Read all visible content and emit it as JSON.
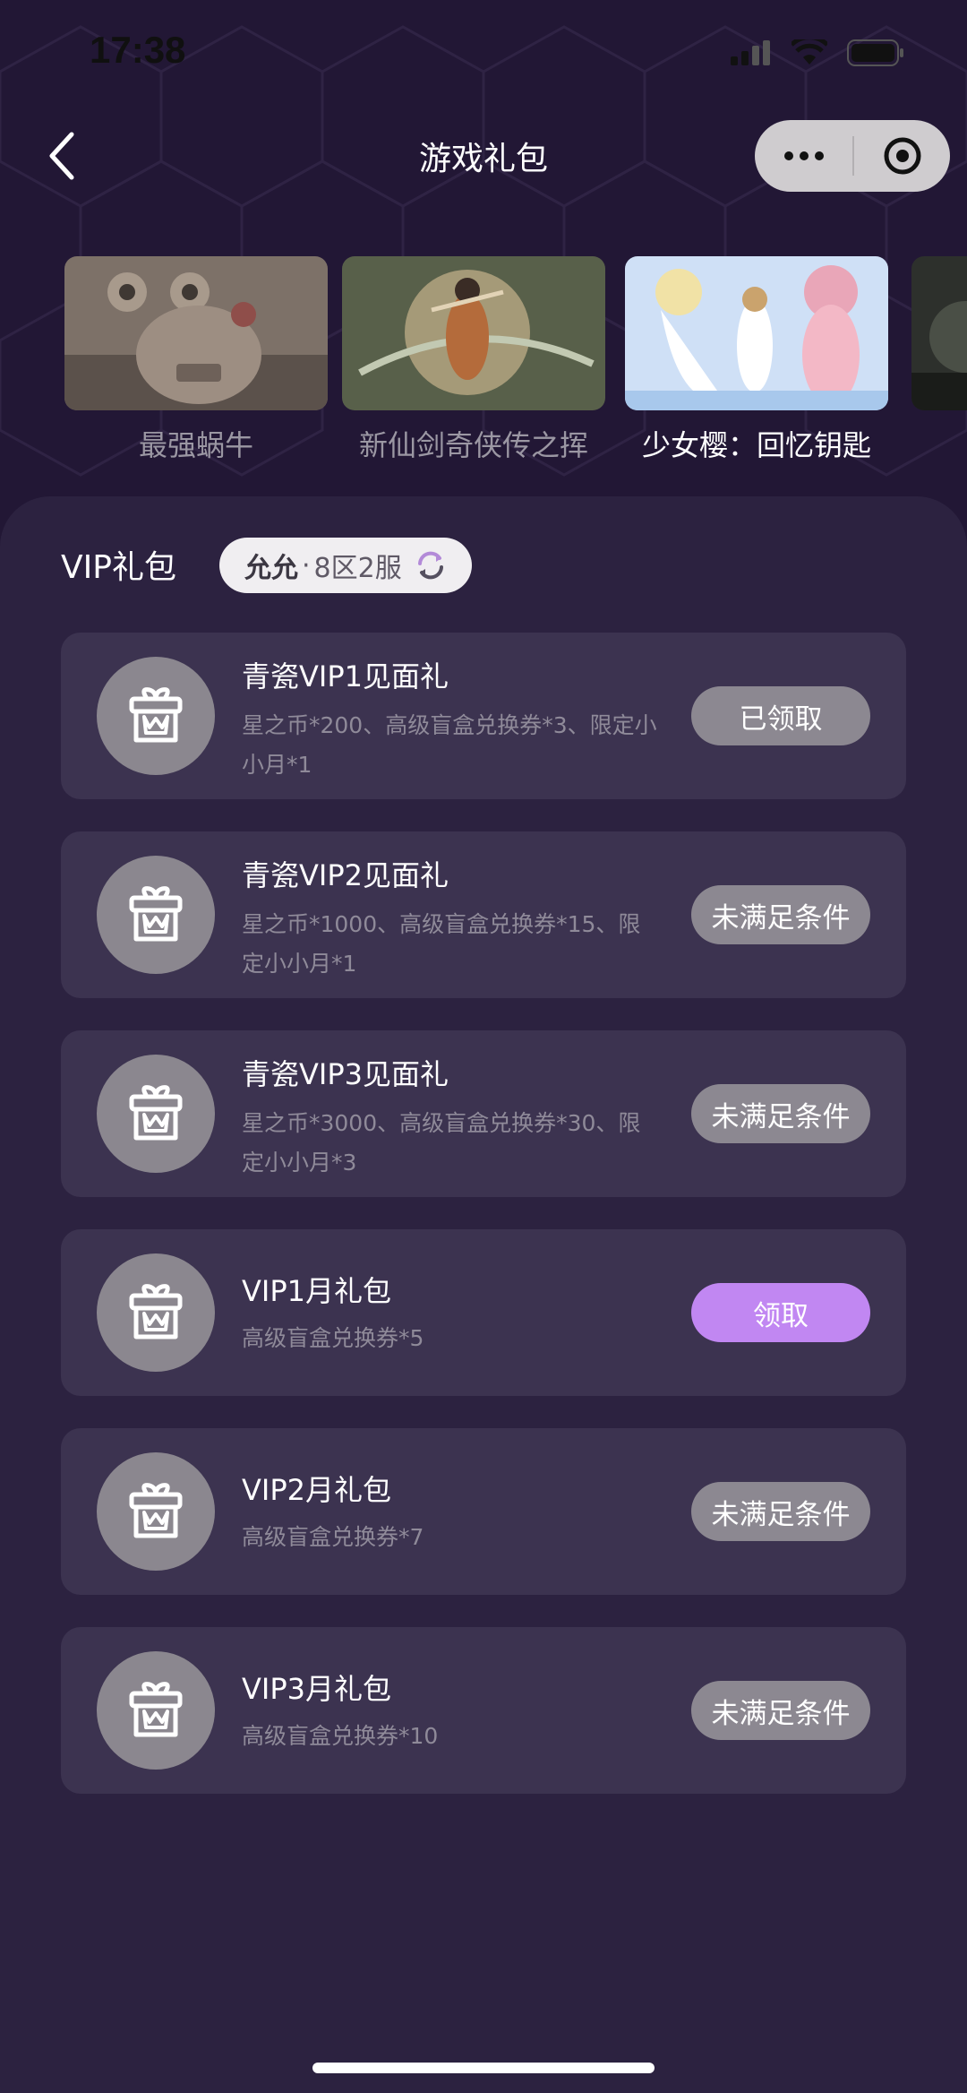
{
  "status_bar": {
    "time": "17:38"
  },
  "nav": {
    "title": "游戏礼包"
  },
  "games": [
    {
      "name": "最强蜗牛",
      "active": false
    },
    {
      "name": "新仙剑奇侠传之挥",
      "active": false
    },
    {
      "name": "少女樱：回忆钥匙",
      "active": true
    }
  ],
  "vip_section": {
    "title": "VIP礼包",
    "server": {
      "game": "允允",
      "separator": "·",
      "zone": "8区2服"
    }
  },
  "gifts": [
    {
      "name": "青瓷VIP1见面礼",
      "desc": "星之币*200、高级盲盒兑换券*3、限定小小月*1",
      "button": "已领取",
      "state": "claimed"
    },
    {
      "name": "青瓷VIP2见面礼",
      "desc": "星之币*1000、高级盲盒兑换券*15、限定小小月*1",
      "button": "未满足条件",
      "state": "locked"
    },
    {
      "name": "青瓷VIP3见面礼",
      "desc": "星之币*3000、高级盲盒兑换券*30、限定小小月*3",
      "button": "未满足条件",
      "state": "locked"
    },
    {
      "name": "VIP1月礼包",
      "desc": "高级盲盒兑换券*5",
      "button": "领取",
      "state": "available"
    },
    {
      "name": "VIP2月礼包",
      "desc": "高级盲盒兑换券*7",
      "button": "未满足条件",
      "state": "locked"
    },
    {
      "name": "VIP3月礼包",
      "desc": "高级盲盒兑换券*10",
      "button": "未满足条件",
      "state": "locked"
    }
  ],
  "colors": {
    "background": "#221735",
    "panel": "#2c2240",
    "card": "#3c3350",
    "claim_button": "#c187f2",
    "disabled_button": "#8c8891"
  },
  "icons": {
    "back": "chevron-left-icon",
    "more": "more-dots-icon",
    "close": "target-circle-icon",
    "refresh": "refresh-icon",
    "gift": "gift-box-icon"
  }
}
